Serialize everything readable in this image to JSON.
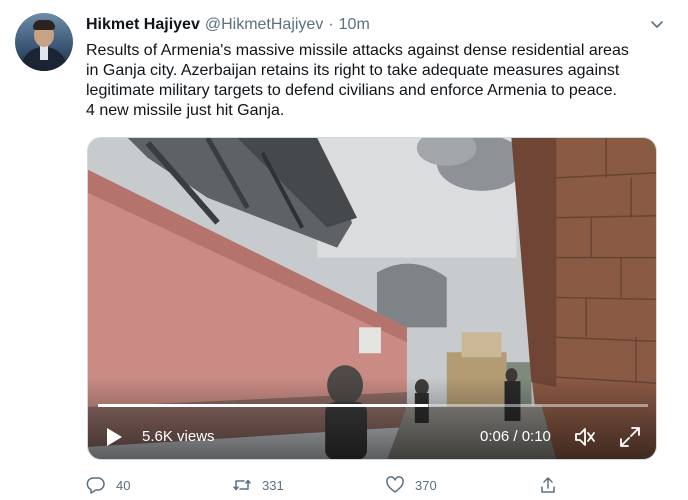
{
  "tweet": {
    "author_name": "Hikmet Hajiyev",
    "handle": "@HikmetHajiyev",
    "separator": "·",
    "time": "10m",
    "text_lines": [
      "Results of Armenia's massive missile attacks against dense residential areas",
      "in Ganja city. Azerbaijan retains its right to take adequate measures against",
      "legitimate military targets to defend civilians and enforce Armenia to peace.",
      "4 new missile just hit Ganja."
    ]
  },
  "video": {
    "views": "5.6K views",
    "timecode": "0:06 / 0:10",
    "progress": 0.6
  },
  "actions": {
    "replies": "40",
    "retweets": "331",
    "likes": "370"
  },
  "icons": {
    "caret": "chevron-down-icon",
    "play": "play-icon",
    "volume": "volume-muted-icon",
    "fullscreen": "fullscreen-icon",
    "reply": "reply-icon",
    "retweet": "retweet-icon",
    "like": "heart-icon",
    "share": "share-icon"
  },
  "colors": {
    "secondary_text": "#5b7083",
    "border": "#cfd9de"
  }
}
